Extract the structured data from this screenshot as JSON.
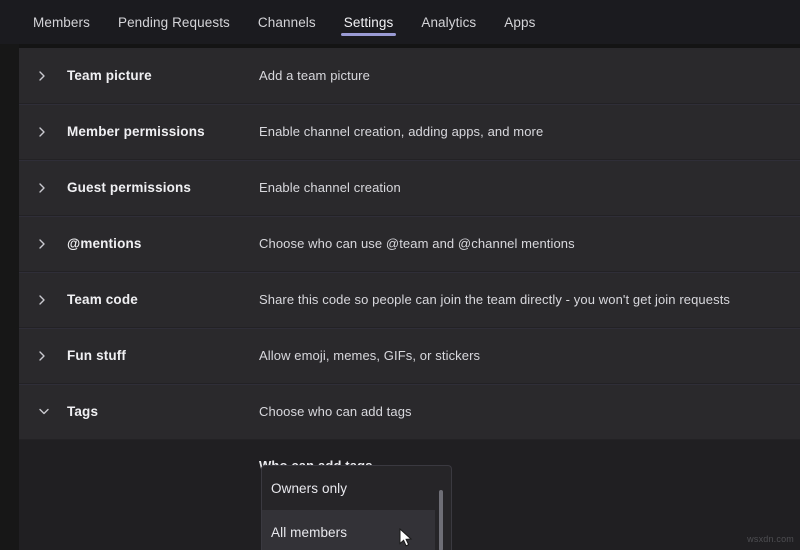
{
  "tabs": [
    {
      "label": "Members",
      "active": false
    },
    {
      "label": "Pending Requests",
      "active": false
    },
    {
      "label": "Channels",
      "active": false
    },
    {
      "label": "Settings",
      "active": true
    },
    {
      "label": "Analytics",
      "active": false
    },
    {
      "label": "Apps",
      "active": false
    }
  ],
  "settings_rows": [
    {
      "title": "Team picture",
      "desc": "Add a team picture",
      "expanded": false
    },
    {
      "title": "Member permissions",
      "desc": "Enable channel creation, adding apps, and more",
      "expanded": false
    },
    {
      "title": "Guest permissions",
      "desc": "Enable channel creation",
      "expanded": false
    },
    {
      "title": "@mentions",
      "desc": "Choose who can use @team and @channel mentions",
      "expanded": false
    },
    {
      "title": "Team code",
      "desc": "Share this code so people can join the team directly - you won't get join requests",
      "expanded": false
    },
    {
      "title": "Fun stuff",
      "desc": "Allow emoji, memes, GIFs, or stickers",
      "expanded": false
    },
    {
      "title": "Tags",
      "desc": "Choose who can add tags",
      "expanded": true
    }
  ],
  "tags_panel": {
    "field_label": "Who can add tags",
    "options": [
      {
        "label": "Owners only",
        "highlighted": false
      },
      {
        "label": "All members",
        "highlighted": true
      }
    ]
  },
  "watermark": "wsxdn.com",
  "colors": {
    "page_background": "#141414",
    "tabbar_background": "#1b1b1f",
    "row_background": "#2a292c",
    "panel_background": "#201f22",
    "active_tab_underline": "#9a9bd4",
    "dropdown_background": "#262528",
    "dropdown_hover": "#333237",
    "scrollbar_thumb": "#6e6e76"
  }
}
